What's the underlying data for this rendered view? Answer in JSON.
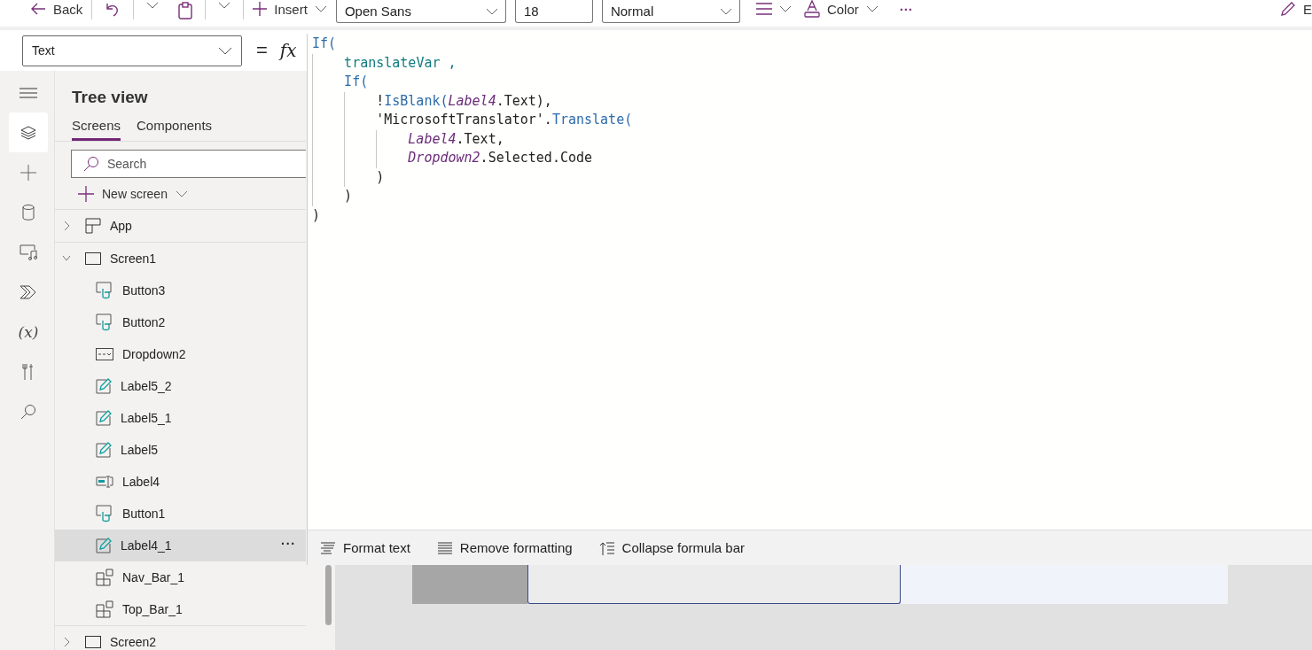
{
  "toolbar": {
    "back": "Back",
    "insert": "Insert",
    "font": "Open Sans",
    "size": "18",
    "weight": "Normal",
    "color_label": "Color",
    "more": "···",
    "edit": "E"
  },
  "formula_bar": {
    "property": "Text",
    "equals": "=",
    "fx": "fx",
    "lines": [
      {
        "tokens": [
          {
            "kind": "fn",
            "text": "If("
          }
        ],
        "children": [
          {
            "tokens": [
              {
                "kind": "var",
                "text": "translateVar ,"
              }
            ]
          },
          {
            "tokens": [
              {
                "kind": "fn",
                "text": "If("
              }
            ],
            "children": [
              {
                "tokens": [
                  {
                    "kind": "plain",
                    "text": "!"
                  },
                  {
                    "kind": "fn",
                    "text": "IsBlank("
                  },
                  {
                    "kind": "ctrl",
                    "text": "Label4"
                  },
                  {
                    "kind": "plain",
                    "text": ".Text),"
                  }
                ]
              },
              {
                "tokens": [
                  {
                    "kind": "plain",
                    "text": "'MicrosoftTranslator'."
                  },
                  {
                    "kind": "fn",
                    "text": "Translate("
                  }
                ],
                "children": [
                  {
                    "tokens": [
                      {
                        "kind": "ctrl",
                        "text": "Label4"
                      },
                      {
                        "kind": "plain",
                        "text": ".Text,"
                      }
                    ]
                  },
                  {
                    "tokens": [
                      {
                        "kind": "ctrl",
                        "text": "Dropdown2"
                      },
                      {
                        "kind": "plain",
                        "text": ".Selected.Code"
                      }
                    ]
                  }
                ]
              },
              {
                "tokens": [
                  {
                    "kind": "plain",
                    "text": ")"
                  }
                ]
              }
            ]
          },
          {
            "tokens": [
              {
                "kind": "plain",
                "text": ")"
              }
            ]
          }
        ]
      },
      {
        "tokens": [
          {
            "kind": "plain",
            "text": ")"
          }
        ]
      }
    ],
    "actions": [
      {
        "kind": "format",
        "label": "Format text"
      },
      {
        "kind": "remove",
        "label": "Remove formatting"
      },
      {
        "kind": "collapse",
        "label": "Collapse formula bar"
      }
    ]
  },
  "rail": [
    {
      "kind": "menu",
      "selected": false
    },
    {
      "kind": "layers",
      "selected": true
    },
    {
      "kind": "plus",
      "selected": false
    },
    {
      "kind": "data",
      "selected": false
    },
    {
      "kind": "media",
      "selected": false
    },
    {
      "kind": "automate",
      "selected": false
    },
    {
      "kind": "variables",
      "text": "(x)",
      "selected": false
    },
    {
      "kind": "tools",
      "selected": false
    },
    {
      "kind": "search",
      "selected": false
    }
  ],
  "tree_view": {
    "title": "Tree view",
    "tabs": [
      {
        "label": "Screens",
        "selected": true
      },
      {
        "label": "Components",
        "selected": false
      }
    ],
    "search": {
      "placeholder": "Search"
    },
    "new_screen": "New screen",
    "items": [
      {
        "kind": "app",
        "label": "App",
        "expanded": false,
        "selected": false
      },
      {
        "kind": "screen",
        "label": "Screen1",
        "expanded": true,
        "selected": false,
        "children": [
          {
            "kind": "button",
            "label": "Button3",
            "selected": false
          },
          {
            "kind": "button",
            "label": "Button2",
            "selected": false
          },
          {
            "kind": "dropdown",
            "label": "Dropdown2",
            "selected": false
          },
          {
            "kind": "label",
            "label": "Label5_2",
            "selected": false
          },
          {
            "kind": "label",
            "label": "Label5_1",
            "selected": false
          },
          {
            "kind": "label",
            "label": "Label5",
            "selected": false
          },
          {
            "kind": "input",
            "label": "Label4",
            "selected": false
          },
          {
            "kind": "button",
            "label": "Button1",
            "selected": false
          },
          {
            "kind": "label",
            "label": "Label4_1",
            "selected": true
          },
          {
            "kind": "group",
            "label": "Nav_Bar_1",
            "selected": false
          },
          {
            "kind": "group",
            "label": "Top_Bar_1",
            "selected": false
          }
        ]
      },
      {
        "kind": "screen",
        "label": "Screen2",
        "expanded": false,
        "selected": false
      }
    ],
    "row_menu": "···"
  }
}
